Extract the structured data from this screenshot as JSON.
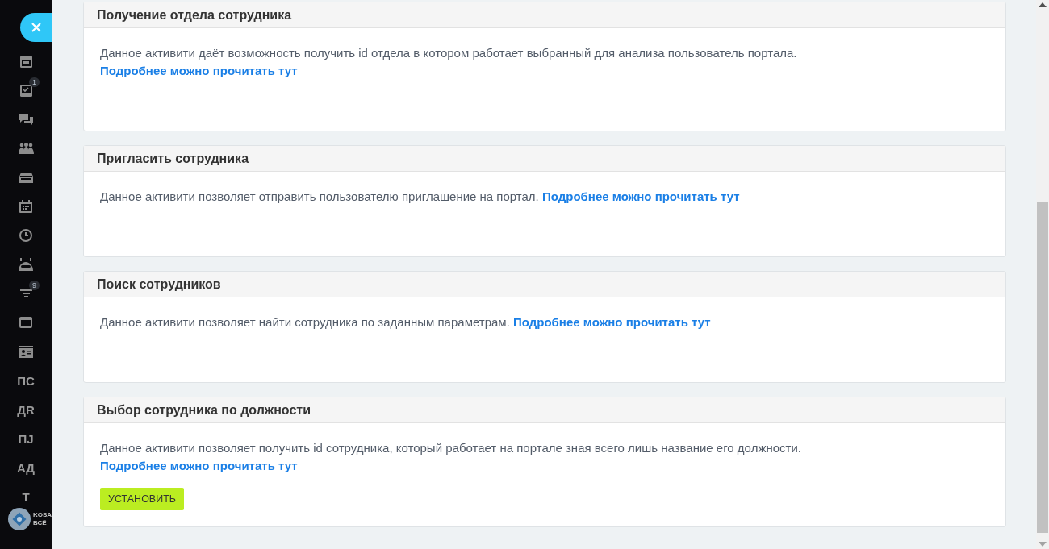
{
  "sidebar": {
    "items": [
      {
        "kind": "icon"
      },
      {
        "kind": "icon",
        "badge": "1"
      },
      {
        "kind": "icon"
      },
      {
        "kind": "icon"
      },
      {
        "kind": "icon"
      },
      {
        "kind": "icon"
      },
      {
        "kind": "icon"
      },
      {
        "kind": "icon"
      },
      {
        "kind": "icon",
        "badge": "9"
      },
      {
        "kind": "icon"
      },
      {
        "kind": "icon"
      },
      {
        "kind": "text",
        "label": "ПС"
      },
      {
        "kind": "text",
        "label": "ДR"
      },
      {
        "kind": "text",
        "label": "ПJ"
      },
      {
        "kind": "text",
        "label": "АД"
      },
      {
        "kind": "text",
        "label": "Т"
      }
    ],
    "logo": {
      "line_1": "KOSA",
      "line_2": "ВСЁ"
    }
  },
  "cards": [
    {
      "title": "Получение отдела сотрудника",
      "description": "Данное активити даёт возможность получить id отдела в котором работает выбранный для анализа пользователь портала.",
      "link": "Подробнее можно прочитать тут"
    },
    {
      "title": "Пригласить сотрудника",
      "description": "Данное активити позволяет отправить пользователю приглашение на портал.",
      "link": "Подробнее можно прочитать тут"
    },
    {
      "title": "Поиск сотрудников",
      "description": "Данное активити позволяет найти сотрудника по заданным параметрам.",
      "link": "Подробнее можно прочитать тут"
    },
    {
      "title": "Выбор сотрудника по должности",
      "description": "Данное активити позволяет получить id сотрудника, который работает на портале зная всего лишь название его должности.",
      "link": "Подробнее можно прочитать тут",
      "button": "УСТАНОВИТЬ"
    }
  ]
}
